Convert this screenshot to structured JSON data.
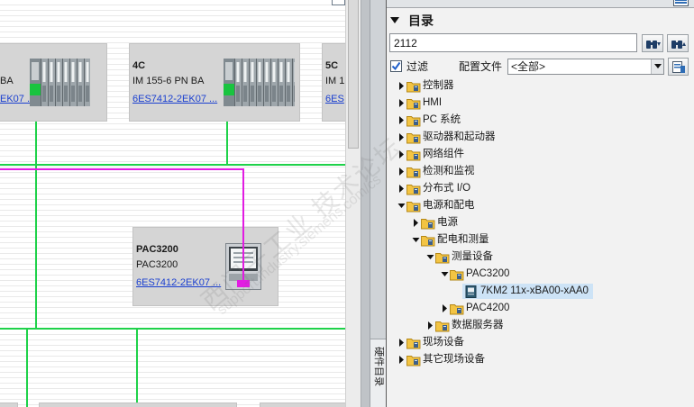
{
  "network_view": {
    "devices": [
      {
        "type": "BA",
        "order_number": "EK07 ..."
      },
      {
        "name": "4C",
        "type": "IM 155-6 PN BA",
        "order_number": "6ES7412-2EK07 ..."
      },
      {
        "name": "5C",
        "type": "IM 1",
        "order_number": "6ES"
      },
      {
        "name": "PAC3200",
        "type": "PAC3200",
        "order_number": "6ES7412-2EK07 ..."
      }
    ],
    "colors": {
      "profinet_line": "#1fd24a",
      "connection_line": "#e21ce2",
      "device_box": "#d5d5d5",
      "link_text": "#1a3fd0"
    }
  },
  "side_tabs": {
    "active": "硬件目录"
  },
  "catalog": {
    "title": "目录",
    "search_value": "2112",
    "filter_label": "过滤",
    "filter_checked": true,
    "profile_label": "配置文件",
    "profile_value": "<全部>",
    "selected_color": "#cde3f6",
    "tree": [
      {
        "label": "控制器",
        "expanded": false,
        "icon": "folder-icon"
      },
      {
        "label": "HMI",
        "expanded": false,
        "icon": "folder-icon"
      },
      {
        "label": "PC 系统",
        "expanded": false,
        "icon": "folder-icon"
      },
      {
        "label": "驱动器和起动器",
        "expanded": false,
        "icon": "folder-icon"
      },
      {
        "label": "网络组件",
        "expanded": false,
        "icon": "folder-icon"
      },
      {
        "label": "检测和监视",
        "expanded": false,
        "icon": "folder-icon"
      },
      {
        "label": "分布式 I/O",
        "expanded": false,
        "icon": "folder-icon"
      },
      {
        "label": "电源和配电",
        "expanded": true,
        "icon": "folder-icon",
        "children": [
          {
            "label": "电源",
            "expanded": false,
            "icon": "folder-icon"
          },
          {
            "label": "配电和测量",
            "expanded": true,
            "icon": "folder-icon",
            "children": [
              {
                "label": "测量设备",
                "expanded": true,
                "icon": "folder-icon",
                "children": [
                  {
                    "label": "PAC3200",
                    "expanded": true,
                    "icon": "folder-icon",
                    "children": [
                      {
                        "label": "7KM2 11x-xBA00-xAA0",
                        "leaf": true,
                        "selected": true,
                        "icon": "device-icon"
                      }
                    ]
                  },
                  {
                    "label": "PAC4200",
                    "expanded": false,
                    "icon": "folder-icon"
                  }
                ]
              },
              {
                "label": "数据服务器",
                "expanded": false,
                "icon": "folder-icon"
              }
            ]
          }
        ]
      },
      {
        "label": "现场设备",
        "expanded": false,
        "icon": "folder-icon"
      },
      {
        "label": "其它现场设备",
        "expanded": false,
        "icon": "folder-icon"
      }
    ]
  },
  "watermark": {
    "line1": "西门子工业 技术论坛",
    "line2": "support.industry.siemens.com/cs"
  }
}
